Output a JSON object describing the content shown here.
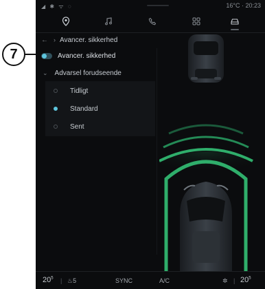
{
  "callout": {
    "number": "7"
  },
  "status": {
    "left_icons": "◢ ✱ ᯤ ◌",
    "right": "16°C · 20:23"
  },
  "nav": {
    "items": [
      {
        "name": "nav-location-icon",
        "active": false
      },
      {
        "name": "nav-music-icon",
        "active": false
      },
      {
        "name": "nav-phone-icon",
        "active": false
      },
      {
        "name": "nav-apps-icon",
        "active": false
      },
      {
        "name": "nav-car-icon",
        "active": true
      }
    ]
  },
  "breadcrumb": {
    "label": "Avancer. sikkerhed"
  },
  "toggle_setting": {
    "label": "Avancer. sikkerhed",
    "on": true
  },
  "section": {
    "label": "Advarsel forudseende"
  },
  "options": [
    {
      "label": "Tidligt",
      "selected": false
    },
    {
      "label": "Standard",
      "selected": true
    },
    {
      "label": "Sent",
      "selected": false
    }
  ],
  "footer": {
    "temp_left": "20",
    "temp_left_sup": "5",
    "seat_label": "5",
    "sync": "SYNC",
    "ac": "A/C",
    "temp_right": "20",
    "temp_right_sup": "5"
  },
  "colors": {
    "accent": "#5ec6de",
    "sensor_green": "#2fae6b",
    "background": "#0b0c0e"
  }
}
